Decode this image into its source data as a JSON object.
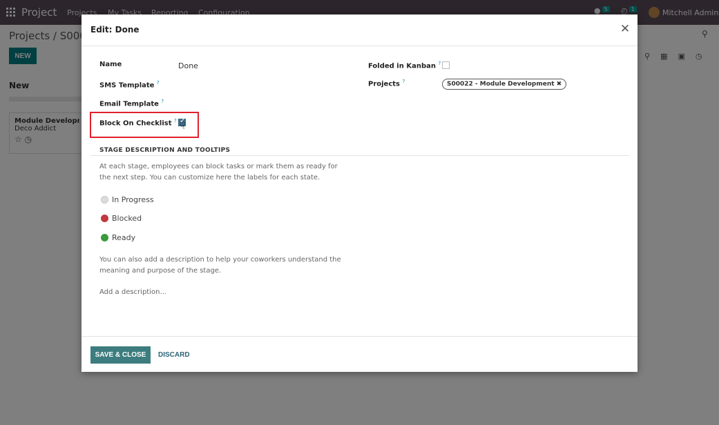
{
  "app": {
    "title": "Project",
    "menu": [
      "Projects",
      "My Tasks",
      "Reporting",
      "Configuration"
    ],
    "messages_count": "5",
    "activities_count": "1",
    "user": "Mitchell Admin",
    "breadcrumb": "Projects / S000",
    "new_label": "NEW",
    "column_title": "New",
    "card": {
      "title": "Module Developme",
      "customer": "Deco Addict"
    }
  },
  "modal": {
    "title": "Edit: Done",
    "fields": {
      "name_label": "Name",
      "name_value": "Done",
      "sms_label": "SMS Template",
      "email_label": "Email Template",
      "block_label": "Block On Checklist",
      "block_checked": true,
      "folded_label": "Folded in Kanban",
      "folded_checked": false,
      "projects_label": "Projects",
      "projects_tag": "S00022 - Module Development"
    },
    "help_mark": "?",
    "section_title": "STAGE DESCRIPTION AND TOOLTIPS",
    "section_text": "At each stage, employees can block tasks or mark them as ready for the next step. You can customize here the labels for each state.",
    "states": [
      {
        "label": "In Progress",
        "color": "#dcdcdc"
      },
      {
        "label": "Blocked",
        "color": "#c1393e"
      },
      {
        "label": "Ready",
        "color": "#3b9a3b"
      }
    ],
    "description_help": "You can also add a description to help your coworkers understand the meaning and purpose of the stage.",
    "description_placeholder": "Add a description...",
    "save_label": "SAVE & CLOSE",
    "discard_label": "DISCARD"
  },
  "colors": {
    "primary": "#3d7d7f",
    "highlight": "#e0202a",
    "navbar": "#5a4a59"
  }
}
